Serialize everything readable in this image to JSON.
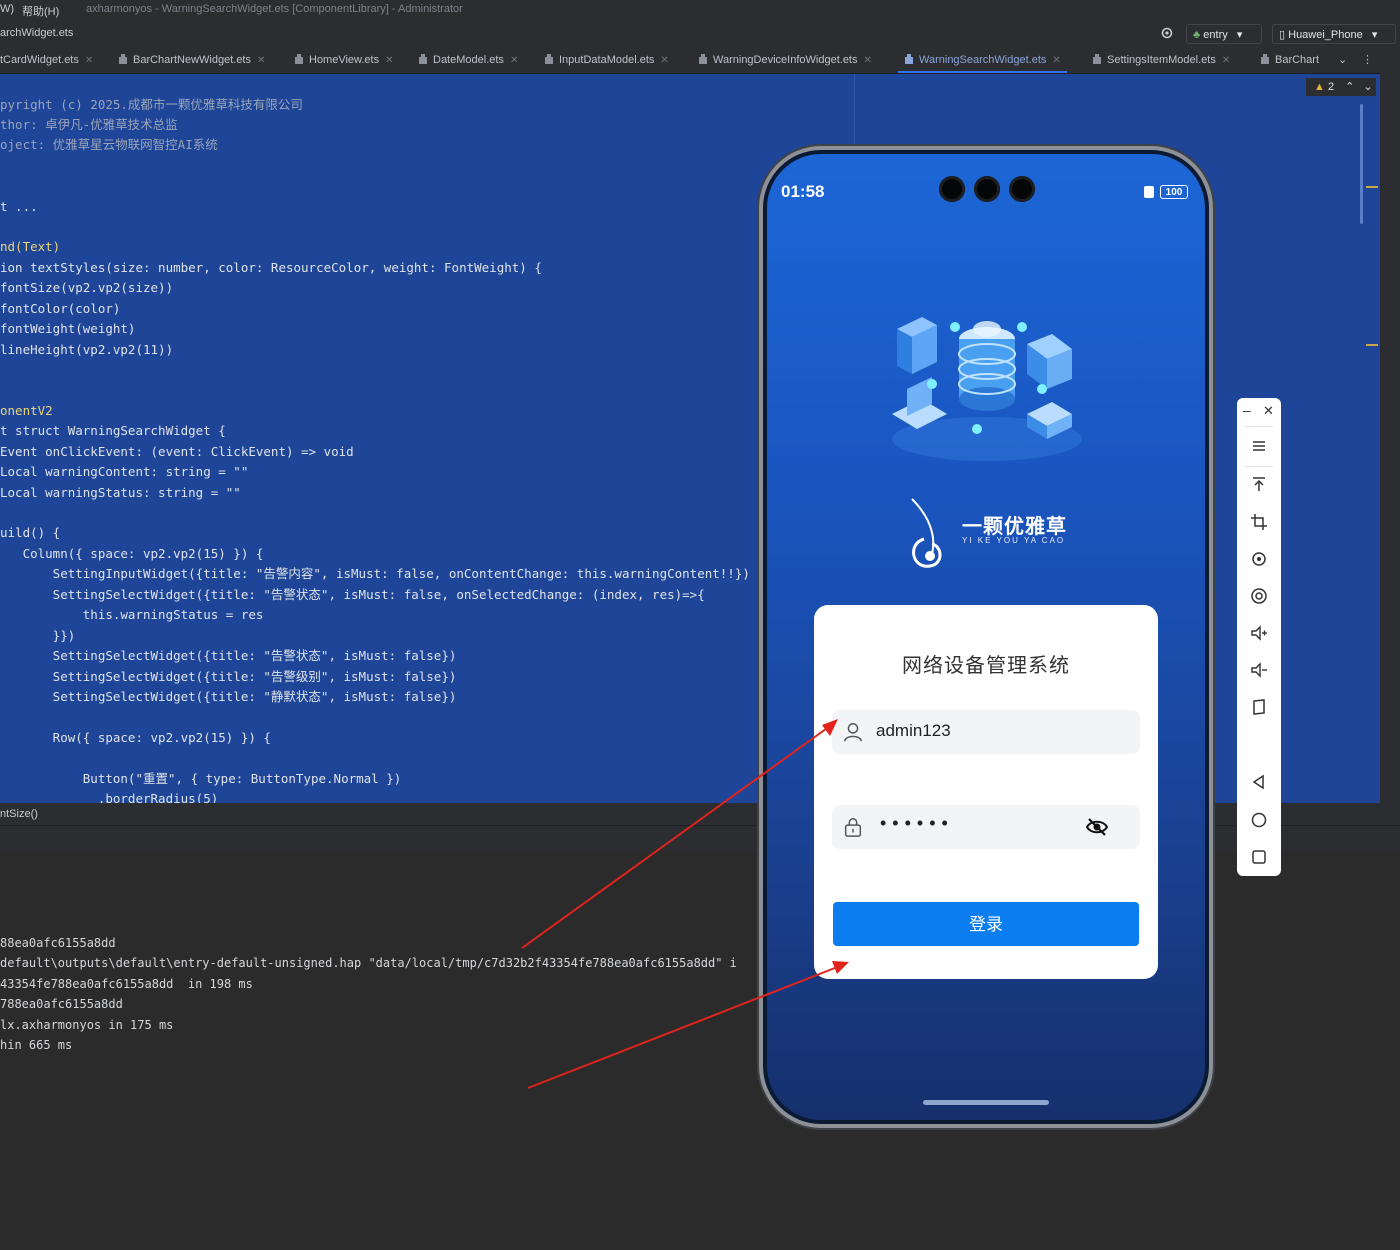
{
  "menubar": {
    "partial_menu": "W)",
    "help_menu": "帮助(H)",
    "window_title": "axharmonyos - WarningSearchWidget.ets [ComponentLibrary] - Administrator"
  },
  "toolbar": {
    "breadcrumb": "archWidget.ets",
    "module_selector": "entry",
    "device_selector": "Huawei_Phone"
  },
  "tabs": [
    {
      "label": "tCardWidget.ets",
      "active": false
    },
    {
      "label": "BarChartNewWidget.ets",
      "active": false
    },
    {
      "label": "HomeView.ets",
      "active": false
    },
    {
      "label": "DateModel.ets",
      "active": false
    },
    {
      "label": "InputDataModel.ets",
      "active": false
    },
    {
      "label": "WarningDeviceInfoWidget.ets",
      "active": false
    },
    {
      "label": "WarningSearchWidget.ets",
      "active": true
    },
    {
      "label": "SettingsItemModel.ets",
      "active": false
    },
    {
      "label": "BarChart",
      "active": false
    }
  ],
  "editor": {
    "warning_count": "2",
    "lines": {
      "l1": "pyright (c) 2025.成都市一颗优雅草科技有限公司",
      "l2": "thor: 卓伊凡-优雅草技术总监",
      "l3": "oject: 优雅草星云物联网智控AI系统",
      "l4": "t ...",
      "l5": "nd(Text)",
      "l6": "ion textStyles(size: number, color: ResourceColor, weight: FontWeight) {",
      "l7": "fontSize(vp2.vp2(size))",
      "l8": "fontColor(color)",
      "l9": "fontWeight(weight)",
      "l10": "lineHeight(vp2.vp2(11))",
      "l11": "onentV2",
      "l12": "t struct WarningSearchWidget {",
      "l13": "Event onClickEvent: (event: ClickEvent) => void",
      "l14": "Local warningContent: string = \"\"",
      "l15": "Local warningStatus: string = \"\"",
      "l16": "uild() {",
      "l17": "   Column({ space: vp2.vp2(15) }) {",
      "l18": "       SettingInputWidget({title: \"告警内容\", isMust: false, onContentChange: this.warningContent!!})",
      "l19": "       SettingSelectWidget({title: \"告警状态\", isMust: false, onSelectedChange: (index, res)=>{",
      "l20": "           this.warningStatus = res",
      "l21": "       }})",
      "l22": "       SettingSelectWidget({title: \"告警状态\", isMust: false})",
      "l23": "       SettingSelectWidget({title: \"告警级别\", isMust: false})",
      "l24": "       SettingSelectWidget({title: \"静默状态\", isMust: false})",
      "l25": "       Row({ space: vp2.vp2(15) }) {",
      "l26": "           Button(\"重置\", { type: ButtonType.Normal })",
      "l27": "             .borderRadius(5)"
    }
  },
  "status": {
    "breadcrumb": "ntSize()"
  },
  "console": {
    "lines": [
      "88ea0afc6155a8dd",
      "default\\outputs\\default\\entry-default-unsigned.hap \"data/local/tmp/c7d32b2f43354fe788ea0afc6155a8dd\" i",
      "43354fe788ea0afc6155a8dd  in 198 ms",
      "788ea0afc6155a8dd",
      "lx.axharmonyos in 175 ms",
      "hin 665 ms"
    ]
  },
  "phone": {
    "time": "01:58",
    "battery": "100",
    "brand_name": "一颗优雅草",
    "brand_sub": "YI KE YOU YA CAO",
    "card_title": "网络设备管理系统",
    "username": "admin123",
    "password_mask": "••••••",
    "login_label": "登录"
  },
  "colors": {
    "editor_bg": "#1e4597",
    "accent": "#3574f0",
    "login_button": "#0a7ef0",
    "arrow": "#e0241b"
  }
}
